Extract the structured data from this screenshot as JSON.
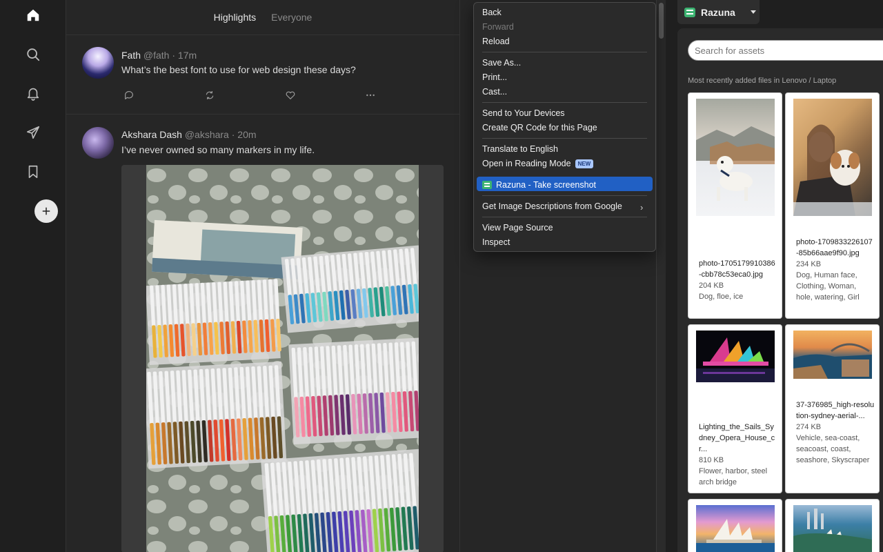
{
  "feed": {
    "tabs": [
      {
        "label": "Highlights",
        "active": true
      },
      {
        "label": "Everyone",
        "active": false
      }
    ],
    "posts": [
      {
        "name": "Fath",
        "handle": "@fath · 17m",
        "text": "What’s the best font to use for web design these days?"
      },
      {
        "name": "Akshara Dash",
        "handle": "@akshara · 20m",
        "text": "I’ve never owned so many markers in my life."
      }
    ]
  },
  "context_menu": {
    "items": [
      {
        "label": "Back",
        "disabled": false
      },
      {
        "label": "Forward",
        "disabled": true
      },
      {
        "label": "Reload",
        "disabled": false
      },
      {
        "label": "Save As...",
        "disabled": false
      },
      {
        "label": "Print...",
        "disabled": false
      },
      {
        "label": "Cast...",
        "disabled": false
      },
      {
        "label": "Send to Your Devices",
        "disabled": false
      },
      {
        "label": "Create QR Code for this Page",
        "disabled": false
      },
      {
        "label": "Translate to English",
        "disabled": false
      },
      {
        "label": "Open in Reading Mode",
        "disabled": false
      },
      {
        "label": "Razuna - Take screenshot",
        "disabled": false,
        "highlighted": true
      },
      {
        "label": "Get Image Descriptions from Google",
        "disabled": false,
        "submenu": true
      },
      {
        "label": "View Page Source",
        "disabled": false
      },
      {
        "label": "Inspect",
        "disabled": false
      }
    ],
    "new_badge": "NEW"
  },
  "razuna": {
    "title": "Razuna",
    "search_placeholder": "Search for assets",
    "recent_note": "Most recently added files in Lenovo / Laptop",
    "cards": [
      {
        "filename": "photo-1705179910386-cbb78c53eca0.jpg",
        "size": "204 KB",
        "tags": "Dog, floe, ice"
      },
      {
        "filename": "photo-1709833226107-85b66aae9f90.jpg",
        "size": "234 KB",
        "tags": "Dog, Human face, Clothing, Woman, hole, watering, Girl"
      },
      {
        "filename": "Lighting_the_Sails_Sydney_Opera_House_cr...",
        "size": "810 KB",
        "tags": "Flower, harbor, steel arch bridge"
      },
      {
        "filename": "37-376985_high-resolution-sydney-aerial-...",
        "size": "274 KB",
        "tags": "Vehicle, sea-coast, seacoast, coast, seashore, Skyscraper"
      }
    ]
  },
  "colors": {
    "accent": "#2160c4",
    "razuna_green": "#3cb371"
  }
}
